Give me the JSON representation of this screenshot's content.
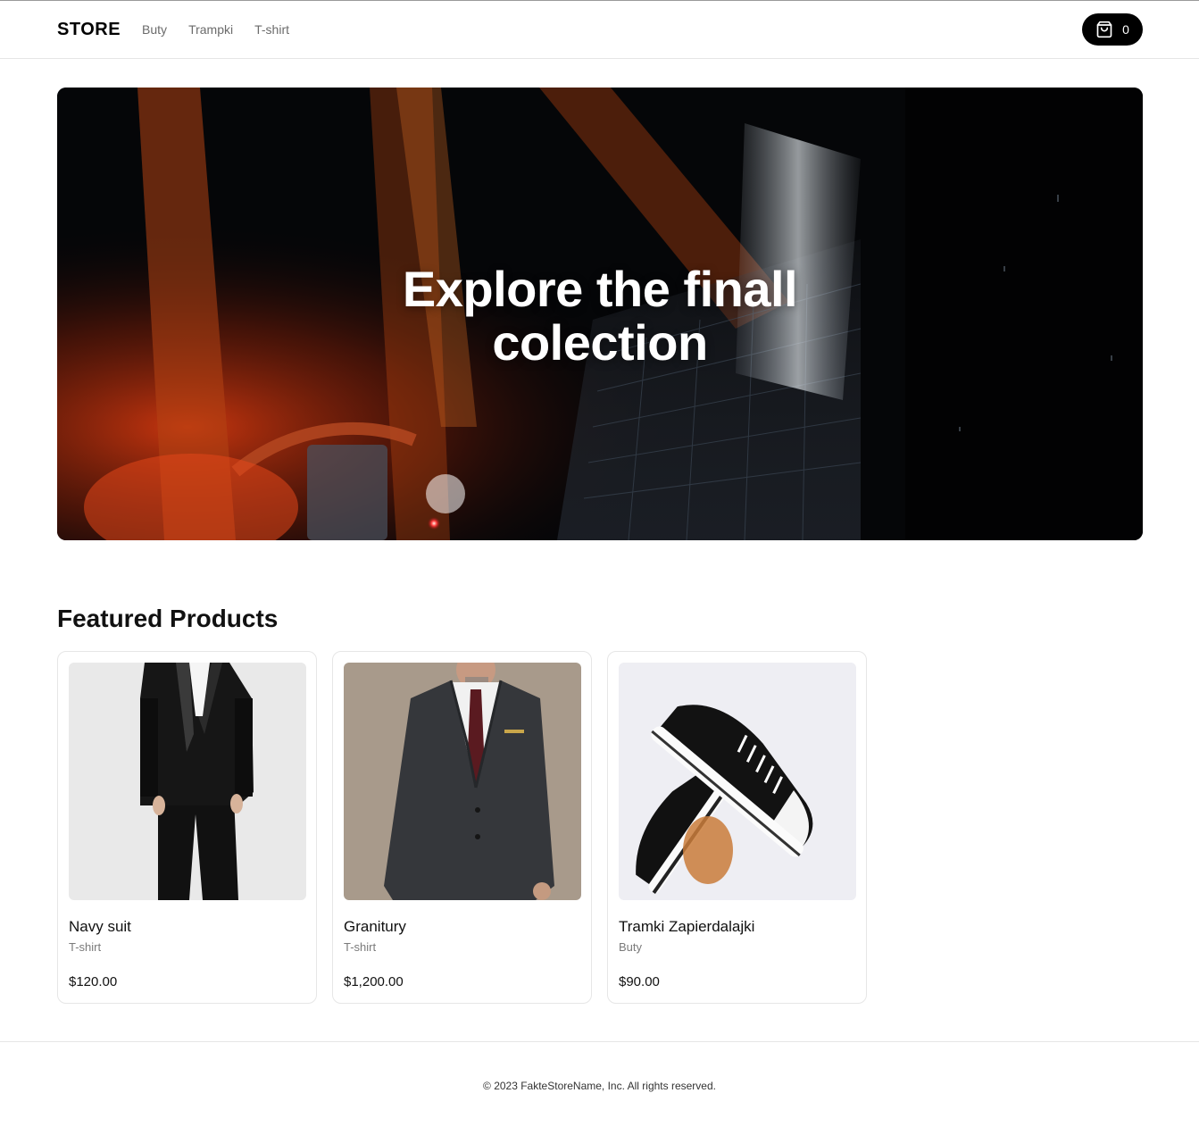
{
  "header": {
    "logo": "STORE",
    "nav": [
      "Buty",
      "Trampki",
      "T-shirt"
    ],
    "cart_count": "0"
  },
  "hero": {
    "title": "Explore the finall colection"
  },
  "featured": {
    "title": "Featured Products",
    "products": [
      {
        "name": "Navy suit",
        "category": "T-shirt",
        "price": "$120.00"
      },
      {
        "name": "Granitury",
        "category": "T-shirt",
        "price": "$1,200.00"
      },
      {
        "name": "Tramki Zapierdalajki",
        "category": "Buty",
        "price": "$90.00"
      }
    ]
  },
  "footer": {
    "copyright": "© 2023 FakteStoreName, Inc. All rights reserved."
  },
  "colors": {
    "accent": "#000000",
    "border": "#e6e6e6",
    "muted_text": "#6b6b6b"
  }
}
